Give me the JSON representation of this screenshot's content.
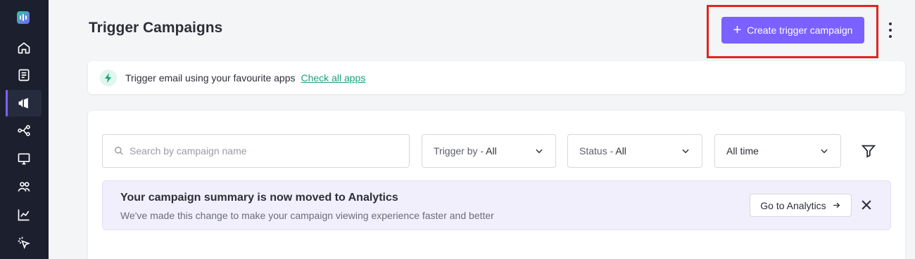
{
  "header": {
    "title": "Trigger Campaigns",
    "create_button_label": "Create trigger campaign"
  },
  "info_banner": {
    "text": "Trigger email using your favourite apps",
    "link": "Check all apps"
  },
  "filters": {
    "search_placeholder": "Search by campaign name",
    "trigger_label": "Trigger by - ",
    "trigger_value": "All",
    "status_label": "Status - ",
    "status_value": "All",
    "time_value": "All time"
  },
  "notice": {
    "title": "Your campaign summary is now moved to Analytics",
    "subtitle": "We've made this change to make your campaign viewing experience faster and better",
    "button_label": "Go to Analytics"
  },
  "colors": {
    "accent": "#7b61ff",
    "sidebar_bg": "#1b1f2e",
    "link_green": "#1aa37a",
    "highlight_red": "#e02424"
  },
  "sidebar": {
    "items": [
      {
        "icon": "home-icon"
      },
      {
        "icon": "document-icon"
      },
      {
        "icon": "megaphone-icon",
        "active": true
      },
      {
        "icon": "workflow-icon"
      },
      {
        "icon": "monitor-icon"
      },
      {
        "icon": "users-icon"
      },
      {
        "icon": "analytics-icon"
      },
      {
        "icon": "cursor-click-icon"
      }
    ]
  }
}
